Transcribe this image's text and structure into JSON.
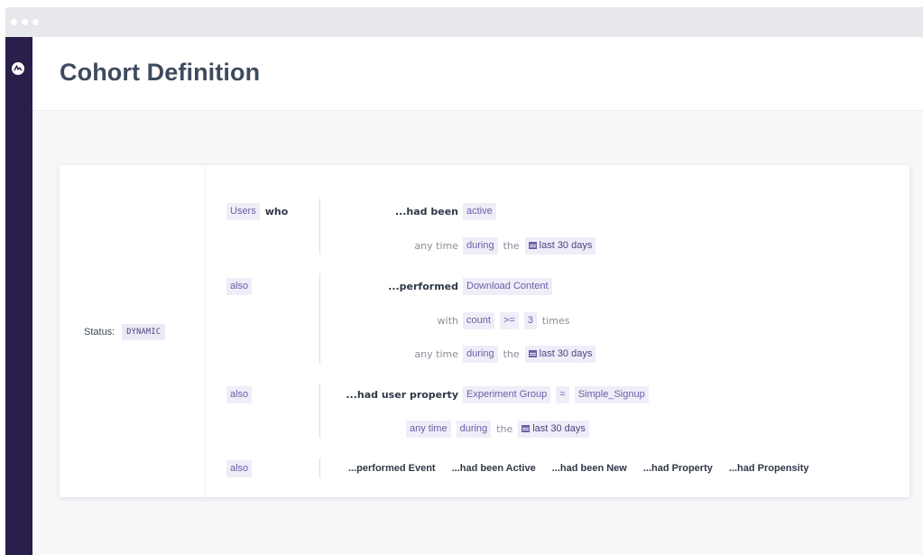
{
  "window": {
    "dots": 3
  },
  "rail": {
    "logo": "amplitude-logo-icon"
  },
  "header": {
    "title": "Cohort Definition"
  },
  "status": {
    "label": "Status:",
    "value": "DYNAMIC"
  },
  "groups": [
    {
      "lhs": {
        "chip": "Users",
        "text": "who"
      },
      "rows": [
        {
          "label": "...had been",
          "tokens": [
            "active"
          ]
        },
        {
          "label": "any time",
          "tokens": [
            "during",
            "the",
            "last 30 days"
          ]
        }
      ]
    },
    {
      "lhs": {
        "chip": "also"
      },
      "rows": [
        {
          "label": "...performed",
          "tokens": [
            "Download Content"
          ]
        },
        {
          "label": "with",
          "tokens": [
            "count",
            ">=",
            "3",
            "times"
          ]
        },
        {
          "label": "any time",
          "tokens": [
            "during",
            "the",
            "last 30 days"
          ]
        }
      ]
    },
    {
      "lhs": {
        "chip": "also"
      },
      "rows": [
        {
          "label": "...had user property",
          "tokens": [
            "Experiment Group",
            "=",
            "Simple_Signup"
          ]
        },
        {
          "label": "any time",
          "tokens": [
            "during",
            "the",
            "last 30 days"
          ]
        }
      ]
    },
    {
      "lhs": {
        "chip": "also"
      },
      "options": [
        "...performed Event",
        "...had been Active",
        "...had been New",
        "...had Property",
        "...had Propensity"
      ]
    }
  ]
}
